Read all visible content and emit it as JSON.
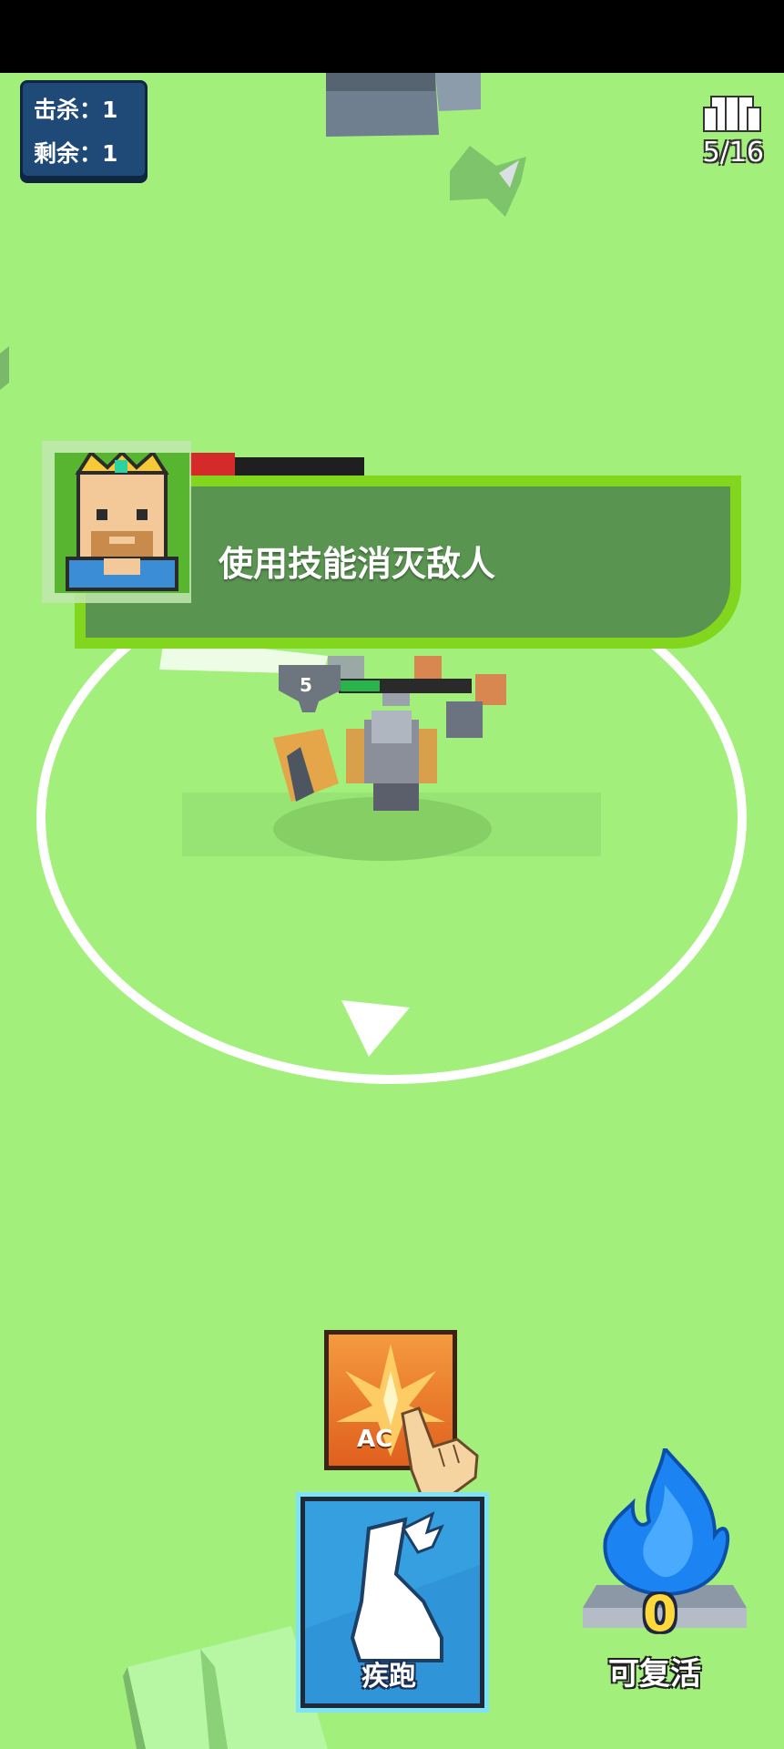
{
  "hud": {
    "kills_label": "击杀：1",
    "remaining_label": "剩余：1",
    "troop_count": "5/16"
  },
  "tutorial": {
    "message": "使用技能消灭敌人"
  },
  "player": {
    "level": "5",
    "health_fraction": 0.3
  },
  "enemy": {
    "health_fraction": 0.1
  },
  "buttons": {
    "skill_label": "AC",
    "sprint_label": "疾跑"
  },
  "revive": {
    "count": "0",
    "label": "可复活"
  },
  "colors": {
    "field": "#a2ef7c",
    "banner_border": "#82d61e",
    "banner_fill": "#5a9451",
    "stats_bg": "#1f4a78",
    "revive_count": "#ffd93a"
  },
  "icons": {
    "troop": "helmet-icon",
    "skill": "burst-icon",
    "sprint": "winged-boot-icon",
    "revive": "blue-flame-icon",
    "pointer": "hand-pointer-icon",
    "direction": "arrow-indicator-icon"
  }
}
